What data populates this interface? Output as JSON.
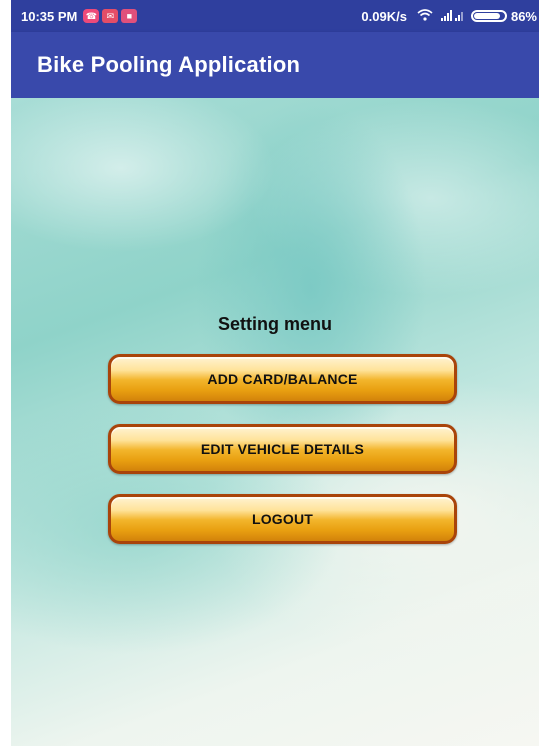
{
  "status_bar": {
    "time": "10:35 PM",
    "net_speed": "0.09K/s",
    "battery_percent": "86%",
    "battery_level": 0.86,
    "notification_icons": [
      "whatsapp-icon",
      "mail-icon",
      "message-icon"
    ]
  },
  "action_bar": {
    "title": "Bike Pooling Application"
  },
  "menu": {
    "title": "Setting menu",
    "buttons": [
      {
        "label": "ADD CARD/BALANCE"
      },
      {
        "label": "EDIT VEHICLE DETAILS"
      },
      {
        "label": "LOGOUT"
      }
    ]
  },
  "colors": {
    "status_bar": "#2f3f9e",
    "action_bar": "#3949ab",
    "button_border": "#a9440a",
    "button_fill": "#f3b52c"
  }
}
